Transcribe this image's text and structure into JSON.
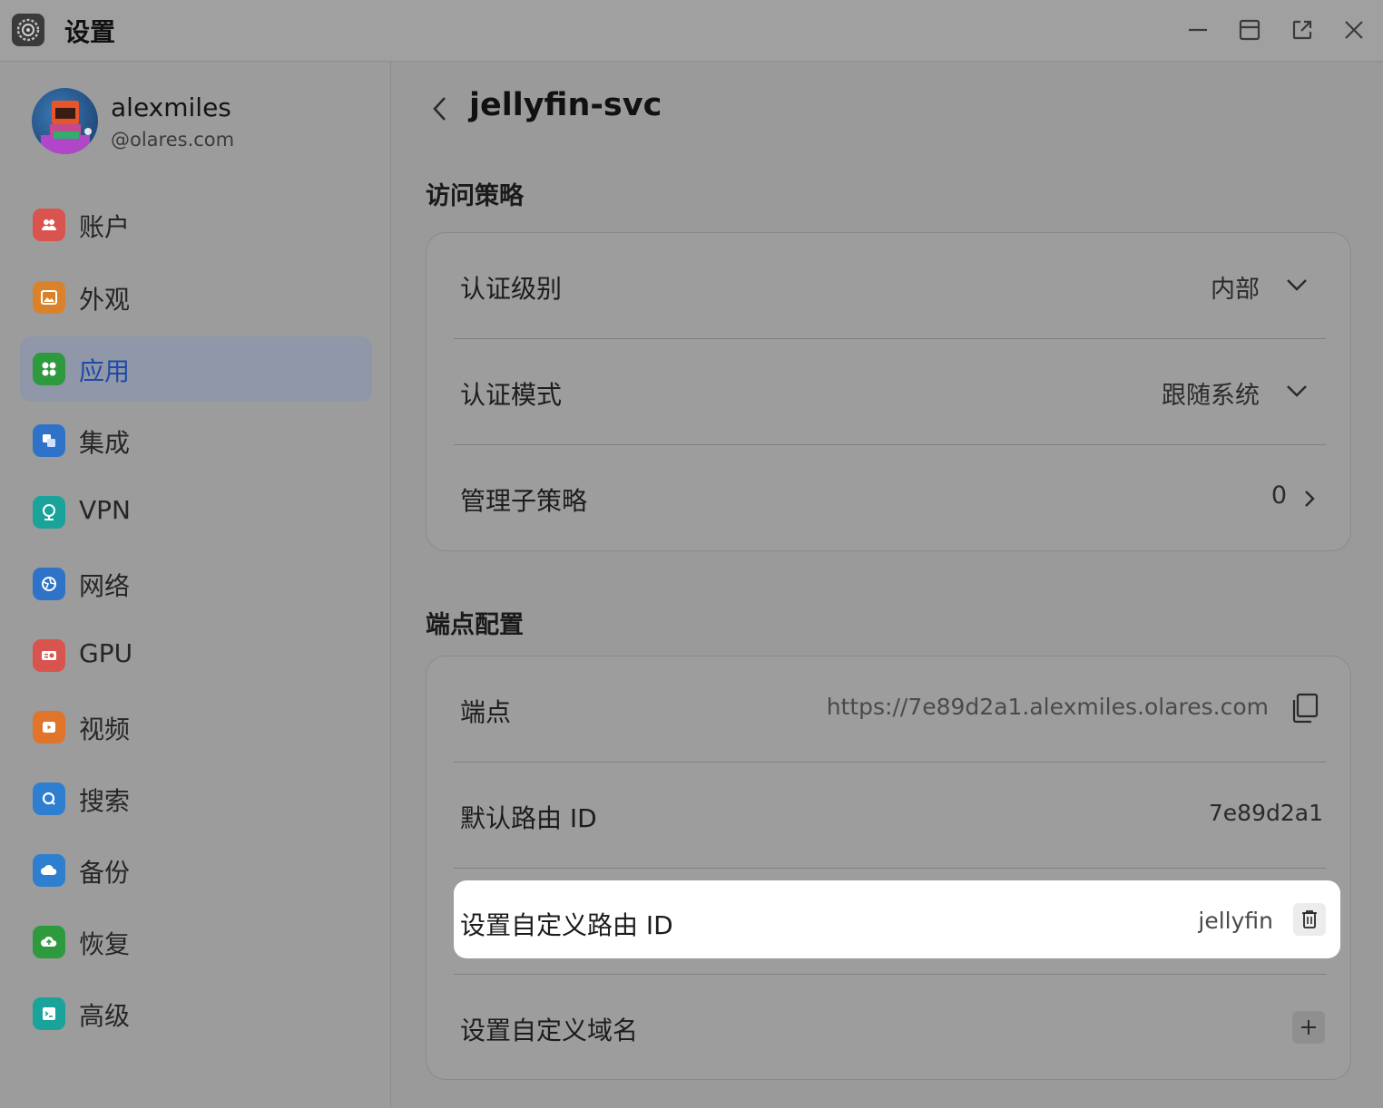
{
  "window": {
    "title": "设置",
    "icons": [
      "settings-gear-icon",
      "minimize-icon",
      "maximize-icon",
      "open-external-icon",
      "close-icon"
    ]
  },
  "user": {
    "name": "alexmiles",
    "domain": "@olares.com"
  },
  "sidebar": {
    "items": [
      {
        "label": "账户",
        "icon": "account-icon",
        "color": "#d9534f"
      },
      {
        "label": "外观",
        "icon": "appearance-icon",
        "color": "#d9822b"
      },
      {
        "label": "应用",
        "icon": "apps-icon",
        "color": "#2e9a3e",
        "active": true
      },
      {
        "label": "集成",
        "icon": "integration-icon",
        "color": "#2f73c9"
      },
      {
        "label": "VPN",
        "icon": "vpn-icon",
        "color": "#1aa39a"
      },
      {
        "label": "网络",
        "icon": "network-icon",
        "color": "#2f73c9"
      },
      {
        "label": "GPU",
        "icon": "gpu-icon",
        "color": "#d9534f"
      },
      {
        "label": "视频",
        "icon": "video-icon",
        "color": "#e0742a"
      },
      {
        "label": "搜索",
        "icon": "search-icon",
        "color": "#2f7fd0"
      },
      {
        "label": "备份",
        "icon": "backup-icon",
        "color": "#2f7fd0"
      },
      {
        "label": "恢复",
        "icon": "restore-icon",
        "color": "#2e9a3e"
      },
      {
        "label": "高级",
        "icon": "advanced-icon",
        "color": "#1aa39a"
      }
    ]
  },
  "main": {
    "title": "jellyfin-svc",
    "access_policy": {
      "section_title": "访问策略",
      "auth_level_label": "认证级别",
      "auth_level_value": "内部",
      "auth_mode_label": "认证模式",
      "auth_mode_value": "跟随系统",
      "sub_policy_label": "管理子策略",
      "sub_policy_count": "0"
    },
    "endpoint_config": {
      "section_title": "端点配置",
      "endpoint_label": "端点",
      "endpoint_value": "https://7e89d2a1.alexmiles.olares.com",
      "default_route_label": "默认路由 ID",
      "default_route_value": "7e89d2a1",
      "custom_route_label": "设置自定义路由 ID",
      "custom_route_value": "jellyfin",
      "custom_domain_label": "设置自定义域名"
    }
  }
}
